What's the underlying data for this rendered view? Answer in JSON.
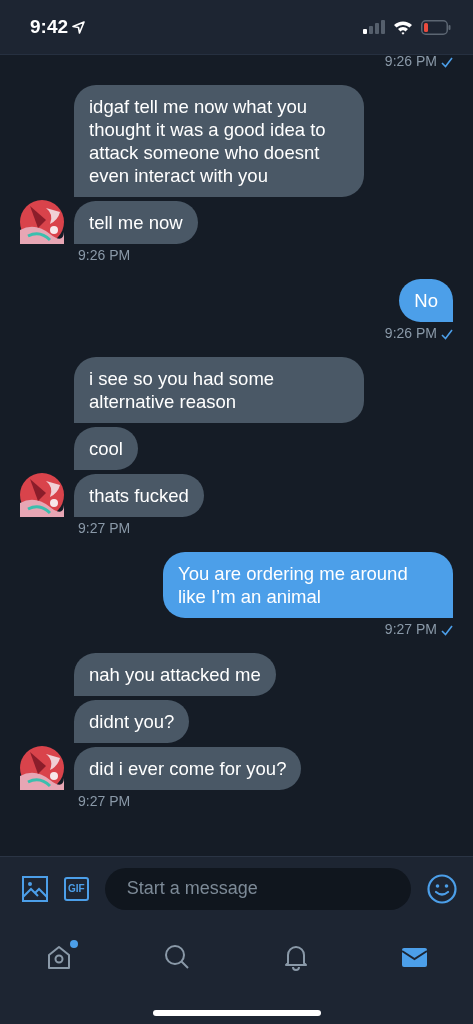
{
  "status_bar": {
    "time": "9:42"
  },
  "groups": [
    {
      "kind": "sent",
      "time": "9:26 PM",
      "read": true
    },
    {
      "kind": "received",
      "messages": [
        "idgaf tell me now what you thought it was a good idea to attack someone who doesnt even interact with you",
        "tell me now"
      ],
      "time": "9:26 PM"
    },
    {
      "kind": "sent",
      "messages": [
        "No"
      ],
      "time": "9:26 PM",
      "read": true
    },
    {
      "kind": "received",
      "messages": [
        "i see so you had some alternative reason",
        "cool",
        "thats fucked"
      ],
      "time": "9:27 PM"
    },
    {
      "kind": "sent",
      "messages": [
        "You are ordering me around like I’m an animal"
      ],
      "time": "9:27 PM",
      "read": true
    },
    {
      "kind": "received",
      "messages": [
        "nah you attacked me",
        "didnt you?",
        "did i ever come for you?"
      ],
      "time": "9:27 PM"
    }
  ],
  "composer": {
    "gif_label": "GIF",
    "placeholder": "Start a message"
  },
  "tabs": [
    {
      "kind": "home",
      "selected": false,
      "dot": true
    },
    {
      "kind": "search",
      "selected": false,
      "dot": false
    },
    {
      "kind": "bell",
      "selected": false,
      "dot": false
    },
    {
      "kind": "mail",
      "selected": true,
      "dot": false
    }
  ]
}
